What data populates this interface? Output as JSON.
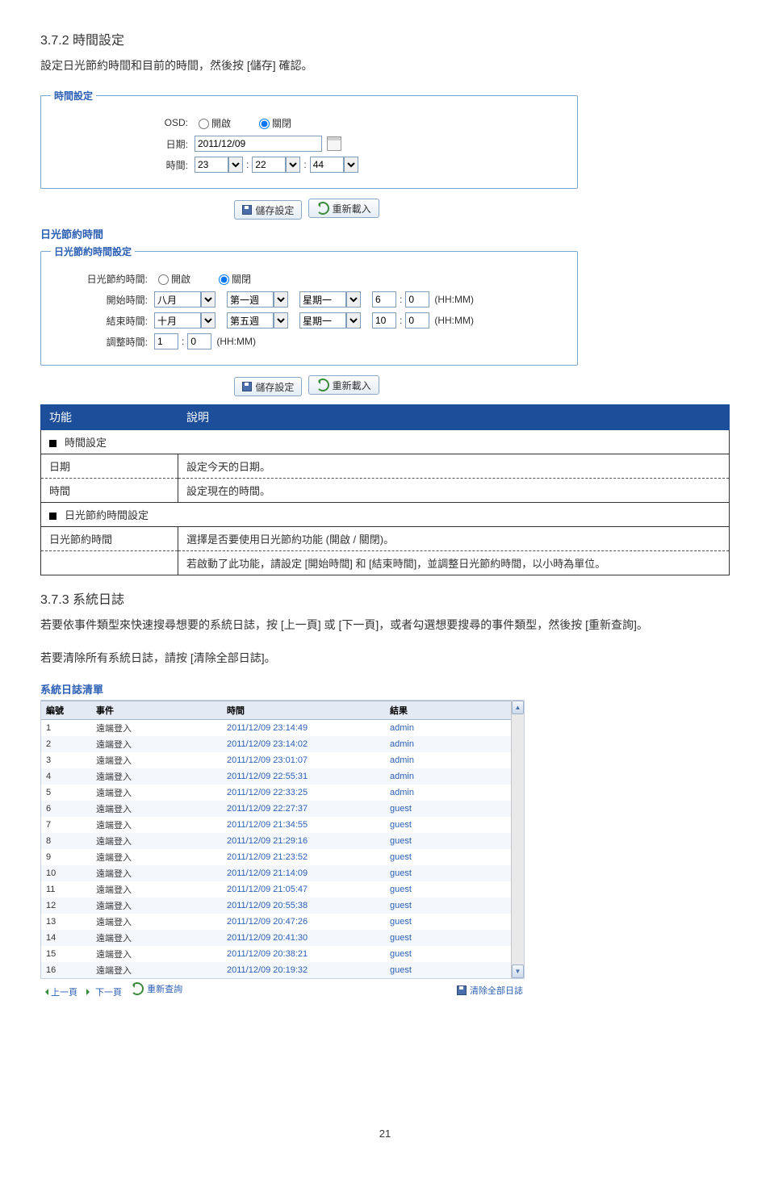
{
  "section372": {
    "title": "3.7.2 時間設定",
    "intro": "設定日光節約時間和目前的時間，然後按 [儲存] 確認。"
  },
  "timePanel": {
    "legend": "時間設定",
    "osd_label": "OSD:",
    "osd_on": "開啟",
    "osd_off": "關閉",
    "date_label": "日期:",
    "date_value": "2011/12/09",
    "time_label": "時間:",
    "hour": "23",
    "min": "22",
    "sec": "44",
    "colon": ":",
    "save": "儲存設定",
    "reload": "重新載入"
  },
  "dst": {
    "heading": "日光節約時間",
    "legend": "日光節約時間設定",
    "dst_label": "日光節約時間:",
    "dst_on": "開啟",
    "dst_off": "關閉",
    "start_label": "開始時間:",
    "end_label": "結束時間:",
    "adjust_label": "調整時間:",
    "month_aug": "八月",
    "month_oct": "十月",
    "week1": "第一週",
    "week5": "第五週",
    "monday": "星期一",
    "start_h": "6",
    "start_m": "0",
    "end_h": "10",
    "end_m": "0",
    "adj_h": "1",
    "adj_m": "0",
    "hhmm": "(HH:MM)",
    "save": "儲存設定",
    "reload": "重新載入"
  },
  "descTable": {
    "col_func": "功能",
    "col_desc": "說明",
    "sub_time": "時間設定",
    "r_date_k": "日期",
    "r_date_v": "設定今天的日期。",
    "r_time_k": "時間",
    "r_time_v": "設定現在的時間。",
    "sub_dst": "日光節約時間設定",
    "r_dst_k": "日光節約時間",
    "r_dst_v": "選擇是否要使用日光節約功能 (開啟 / 關閉)。",
    "r_dst_note": "若啟動了此功能，請設定 [開始時間] 和 [結束時間]，並調整日光節約時間，以小時為單位。"
  },
  "section373": {
    "title": "3.7.3 系統日誌",
    "p1": "若要依事件類型來快速搜尋想要的系統日誌，按 [上一頁] 或 [下一頁]，或者勾選想要搜尋的事件類型，然後按 [重新查詢]。",
    "p2": "若要清除所有系統日誌，請按 [清除全部日誌]。"
  },
  "logPanel": {
    "title": "系統日誌清單",
    "col_idx": "編號",
    "col_event": "事件",
    "col_time": "時間",
    "col_result": "結果",
    "rows": [
      {
        "i": "1",
        "e": "遠端登入",
        "t": "2011/12/09 23:14:49",
        "r": "admin"
      },
      {
        "i": "2",
        "e": "遠端登入",
        "t": "2011/12/09 23:14:02",
        "r": "admin"
      },
      {
        "i": "3",
        "e": "遠端登入",
        "t": "2011/12/09 23:01:07",
        "r": "admin"
      },
      {
        "i": "4",
        "e": "遠端登入",
        "t": "2011/12/09 22:55:31",
        "r": "admin"
      },
      {
        "i": "5",
        "e": "遠端登入",
        "t": "2011/12/09 22:33:25",
        "r": "admin"
      },
      {
        "i": "6",
        "e": "遠端登入",
        "t": "2011/12/09 22:27:37",
        "r": "guest"
      },
      {
        "i": "7",
        "e": "遠端登入",
        "t": "2011/12/09 21:34:55",
        "r": "guest"
      },
      {
        "i": "8",
        "e": "遠端登入",
        "t": "2011/12/09 21:29:16",
        "r": "guest"
      },
      {
        "i": "9",
        "e": "遠端登入",
        "t": "2011/12/09 21:23:52",
        "r": "guest"
      },
      {
        "i": "10",
        "e": "遠端登入",
        "t": "2011/12/09 21:14:09",
        "r": "guest"
      },
      {
        "i": "11",
        "e": "遠端登入",
        "t": "2011/12/09 21:05:47",
        "r": "guest"
      },
      {
        "i": "12",
        "e": "遠端登入",
        "t": "2011/12/09 20:55:38",
        "r": "guest"
      },
      {
        "i": "13",
        "e": "遠端登入",
        "t": "2011/12/09 20:47:26",
        "r": "guest"
      },
      {
        "i": "14",
        "e": "遠端登入",
        "t": "2011/12/09 20:41:30",
        "r": "guest"
      },
      {
        "i": "15",
        "e": "遠端登入",
        "t": "2011/12/09 20:38:21",
        "r": "guest"
      },
      {
        "i": "16",
        "e": "遠端登入",
        "t": "2011/12/09 20:19:32",
        "r": "guest"
      }
    ],
    "prev": "上一頁",
    "next": "下一頁",
    "requery": "重新查詢",
    "clear": "清除全部日誌"
  },
  "pageNumber": "21"
}
